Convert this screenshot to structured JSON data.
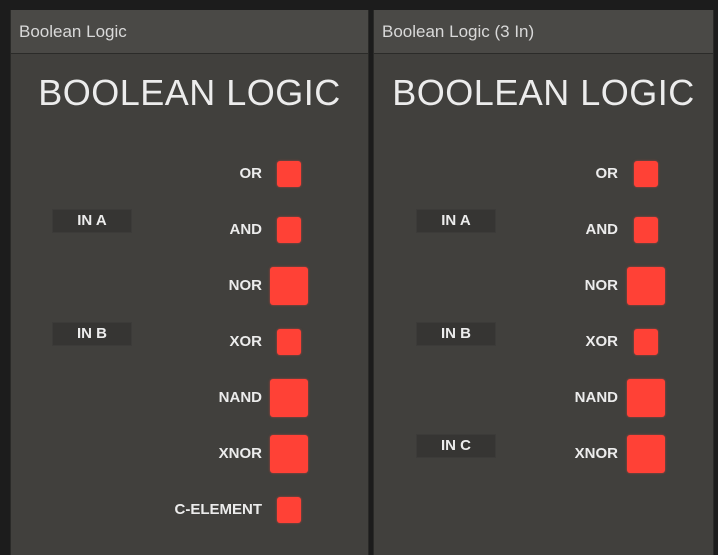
{
  "modules": [
    {
      "header": "Boolean Logic",
      "title": "BOOLEAN LOGIC",
      "inputs": [
        "IN A",
        "IN B"
      ],
      "outputs": [
        "OR",
        "AND",
        "NOR",
        "XOR",
        "NAND",
        "XNOR",
        "C-ELEMENT"
      ]
    },
    {
      "header": "Boolean Logic (3 In)",
      "title": "BOOLEAN LOGIC",
      "inputs": [
        "IN A",
        "IN B",
        "IN C"
      ],
      "outputs": [
        "OR",
        "AND",
        "NOR",
        "XOR",
        "NAND",
        "XNOR"
      ]
    }
  ],
  "colors": {
    "led": "#ff4136",
    "panel": "#41403d",
    "header": "#4a4946",
    "text": "#ececec"
  }
}
